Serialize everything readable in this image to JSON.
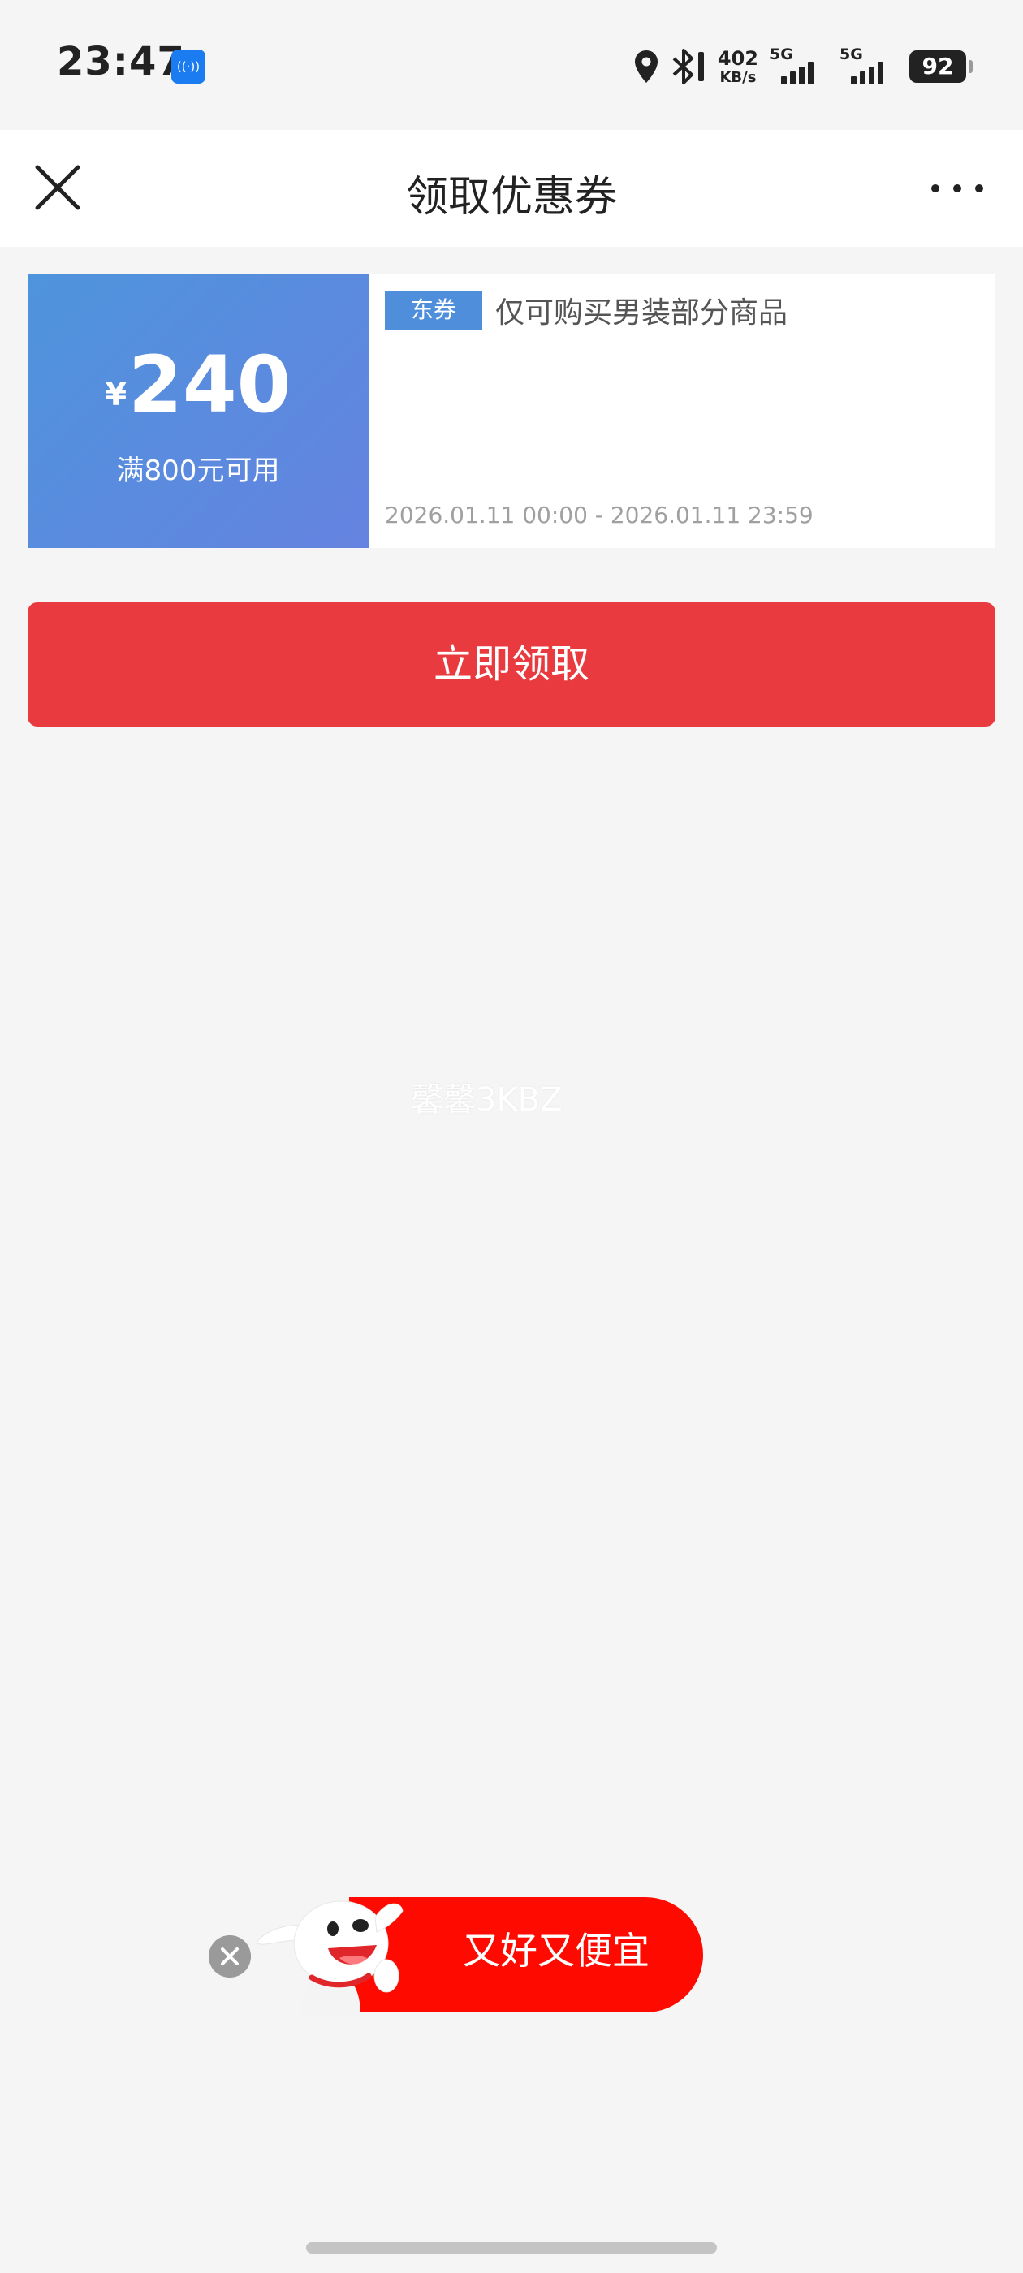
{
  "status_bar": {
    "time": "23:47",
    "speed_value": "402",
    "speed_unit": "KB/s",
    "sim1": "5G",
    "sim2": "5G",
    "battery": "92",
    "icons": [
      "location-icon",
      "bluetooth-icon",
      "signal-icon",
      "battery-icon"
    ]
  },
  "nav": {
    "title": "领取优惠券",
    "close_icon": "close-icon",
    "more_icon": "more-icon"
  },
  "coupon": {
    "currency": "¥",
    "amount": "240",
    "condition": "满800元可用",
    "tag": "东券",
    "description": "仅可购买男装部分商品",
    "validity": "2026.01.11 00:00 - 2026.01.11 23:59",
    "colors": {
      "left_start": "#4e94dc",
      "left_end": "#6583e0",
      "tag": "#4f8edb"
    }
  },
  "claim_button": {
    "label": "立即领取",
    "color": "#e93b3f"
  },
  "watermark": "馨馨3KBZ",
  "floating_banner": {
    "label": "又好又便宜",
    "color": "#ff0a00",
    "close_icon": "close-icon"
  }
}
